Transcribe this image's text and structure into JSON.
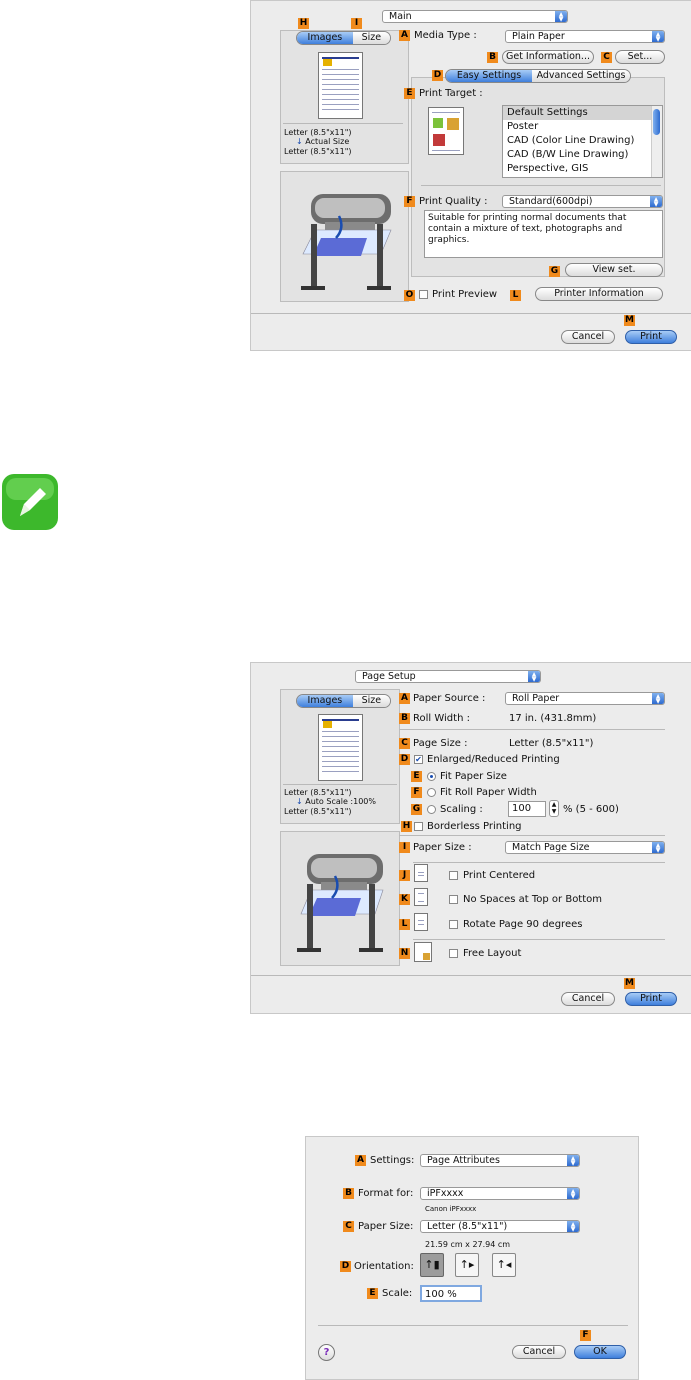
{
  "panel1": {
    "mode_select": "Main",
    "tags": {
      "H": "H",
      "I": "I",
      "A": "A",
      "B": "B",
      "C": "C",
      "D": "D",
      "E": "E",
      "F": "F",
      "G": "G",
      "O": "O",
      "L": "L",
      "M": "M"
    },
    "tab_images": "Images",
    "tab_size": "Size",
    "preview_line1": "Letter (8.5\"x11\")",
    "preview_line2": "Actual Size",
    "preview_line3": "Letter (8.5\"x11\")",
    "media_type_label": "Media Type :",
    "media_type_value": "Plain Paper",
    "get_info_button": "Get Information...",
    "set_button": "Set...",
    "tab_easy": "Easy Settings",
    "tab_advanced": "Advanced Settings",
    "print_target_label": "Print Target :",
    "print_targets": [
      "Default Settings",
      "Poster",
      "CAD (Color Line Drawing)",
      "CAD (B/W Line Drawing)",
      "Perspective, GIS"
    ],
    "print_quality_label": "Print Quality :",
    "print_quality_value": "Standard(600dpi)",
    "description": "Suitable for printing normal documents that contain a mixture of text, photographs and graphics.",
    "view_set_button": "View set.",
    "print_preview_label": "Print Preview",
    "printer_info_button": "Printer Information",
    "cancel_button": "Cancel",
    "print_button": "Print"
  },
  "panel2": {
    "mode_select": "Page Setup",
    "tags": {
      "A": "A",
      "B": "B",
      "C": "C",
      "D": "D",
      "E": "E",
      "F": "F",
      "G": "G",
      "H": "H",
      "I": "I",
      "J": "J",
      "K": "K",
      "L": "L",
      "M": "M",
      "N": "N"
    },
    "tab_images": "Images",
    "tab_size": "Size",
    "preview_line1": "Letter (8.5\"x11\")",
    "preview_line2": "Auto Scale :100%",
    "preview_line3": "Letter (8.5\"x11\")",
    "paper_source_label": "Paper Source :",
    "paper_source_value": "Roll Paper",
    "roll_width_label": "Roll Width :",
    "roll_width_value": "17 in. (431.8mm)",
    "page_size_label": "Page Size :",
    "page_size_value": "Letter (8.5\"x11\")",
    "enlarged_label": "Enlarged/Reduced Printing",
    "fit_paper_label": "Fit Paper Size",
    "fit_roll_label": "Fit Roll Paper Width",
    "scaling_label": "Scaling :",
    "scaling_value": "100",
    "scaling_range": "% (5 - 600)",
    "borderless_label": "Borderless Printing",
    "paper_size_label": "Paper Size :",
    "paper_size_value": "Match Page Size",
    "print_centered_label": "Print Centered",
    "no_spaces_label": "No Spaces at Top or Bottom",
    "rotate_label": "Rotate Page 90 degrees",
    "free_layout_label": "Free Layout",
    "cancel_button": "Cancel",
    "print_button": "Print"
  },
  "panel3": {
    "tags": {
      "A": "A",
      "B": "B",
      "C": "C",
      "D": "D",
      "E": "E",
      "F": "F"
    },
    "settings_label": "Settings:",
    "settings_value": "Page Attributes",
    "format_label": "Format for:",
    "format_value": "iPFxxxx",
    "format_sub": "Canon iPFxxxx",
    "paper_size_label": "Paper Size:",
    "paper_size_value": "Letter (8.5\"x11\")",
    "paper_size_sub": "21.59 cm x 27.94 cm",
    "orientation_label": "Orientation:",
    "scale_label": "Scale:",
    "scale_value": "100 %",
    "help_icon": "?",
    "cancel_button": "Cancel",
    "ok_button": "OK"
  },
  "colors": {
    "tag": "#f08a1c",
    "note_icon": "#3db82c",
    "accent": "#3f7fdc"
  }
}
